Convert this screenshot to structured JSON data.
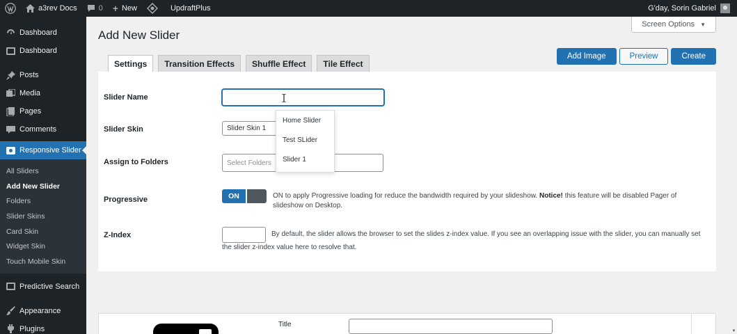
{
  "adminbar": {
    "site_name": "a3rev Docs",
    "comments_count": "0",
    "new_label": "New",
    "plugin_label": "UpdraftPlus",
    "greeting": "G'day, Sorin Gabriel"
  },
  "sidebar": {
    "top_items": [
      {
        "label": "Dashboard",
        "icon": "dashboard-icon"
      },
      {
        "label": "Dashboard",
        "icon": "a3-dashboard-icon"
      },
      {
        "label": "Posts",
        "icon": "pin-icon"
      },
      {
        "label": "Media",
        "icon": "media-icon"
      },
      {
        "label": "Pages",
        "icon": "pages-icon"
      },
      {
        "label": "Comments",
        "icon": "comment-icon"
      }
    ],
    "active_item": {
      "label": "Responsive Slider",
      "icon": "slider-icon"
    },
    "submenu": [
      "All Sliders",
      "Add New Slider",
      "Folders",
      "Slider Skins",
      "Card Skin",
      "Widget Skin",
      "Touch Mobile Skin"
    ],
    "bottom_items": [
      {
        "label": "Predictive Search",
        "icon": "search-plugin-icon"
      },
      {
        "label": "Appearance",
        "icon": "brush-icon"
      },
      {
        "label": "Plugins",
        "icon": "plugin-icon"
      }
    ]
  },
  "page": {
    "title": "Add New Slider",
    "screen_options": "Screen Options",
    "tabs": [
      "Settings",
      "Transition Effects",
      "Shuffle Effect",
      "Tile Effect"
    ],
    "buttons": {
      "add_image": "Add Image",
      "preview": "Preview",
      "create": "Create"
    }
  },
  "form": {
    "slider_name_label": "Slider Name",
    "slider_name_value": "",
    "slider_skin_label": "Slider Skin",
    "slider_skin_value": "Slider Skin 1",
    "assign_label": "Assign to Folders",
    "assign_placeholder": "Select Folders",
    "autocomplete": [
      "Home Slider",
      "Test SLider",
      "Slider 1"
    ],
    "progressive_label": "Progressive",
    "progressive_toggle": "ON",
    "progressive_desc_1": "ON to apply Progressive loading for reduce the bandwidth required by your slideshow.",
    "progressive_desc_notice": "Notice!",
    "progressive_desc_2": "this feature will be disabled Pager of",
    "progressive_desc_3": "slideshow on Desktop.",
    "zindex_label": "Z-Index",
    "zindex_value": "",
    "zindex_desc_1": "By default, the slider allows the browser to set the slides z-index value. If you see an overlapping issue with the slider, you can manually set",
    "zindex_desc_2": "the slider z-index value here to resolve that."
  },
  "lower": {
    "title_label": "Title",
    "title_value": ""
  },
  "colors": {
    "accent": "#2271b1",
    "admin_dark": "#1d2327",
    "submenu_bg": "#2c3338"
  }
}
